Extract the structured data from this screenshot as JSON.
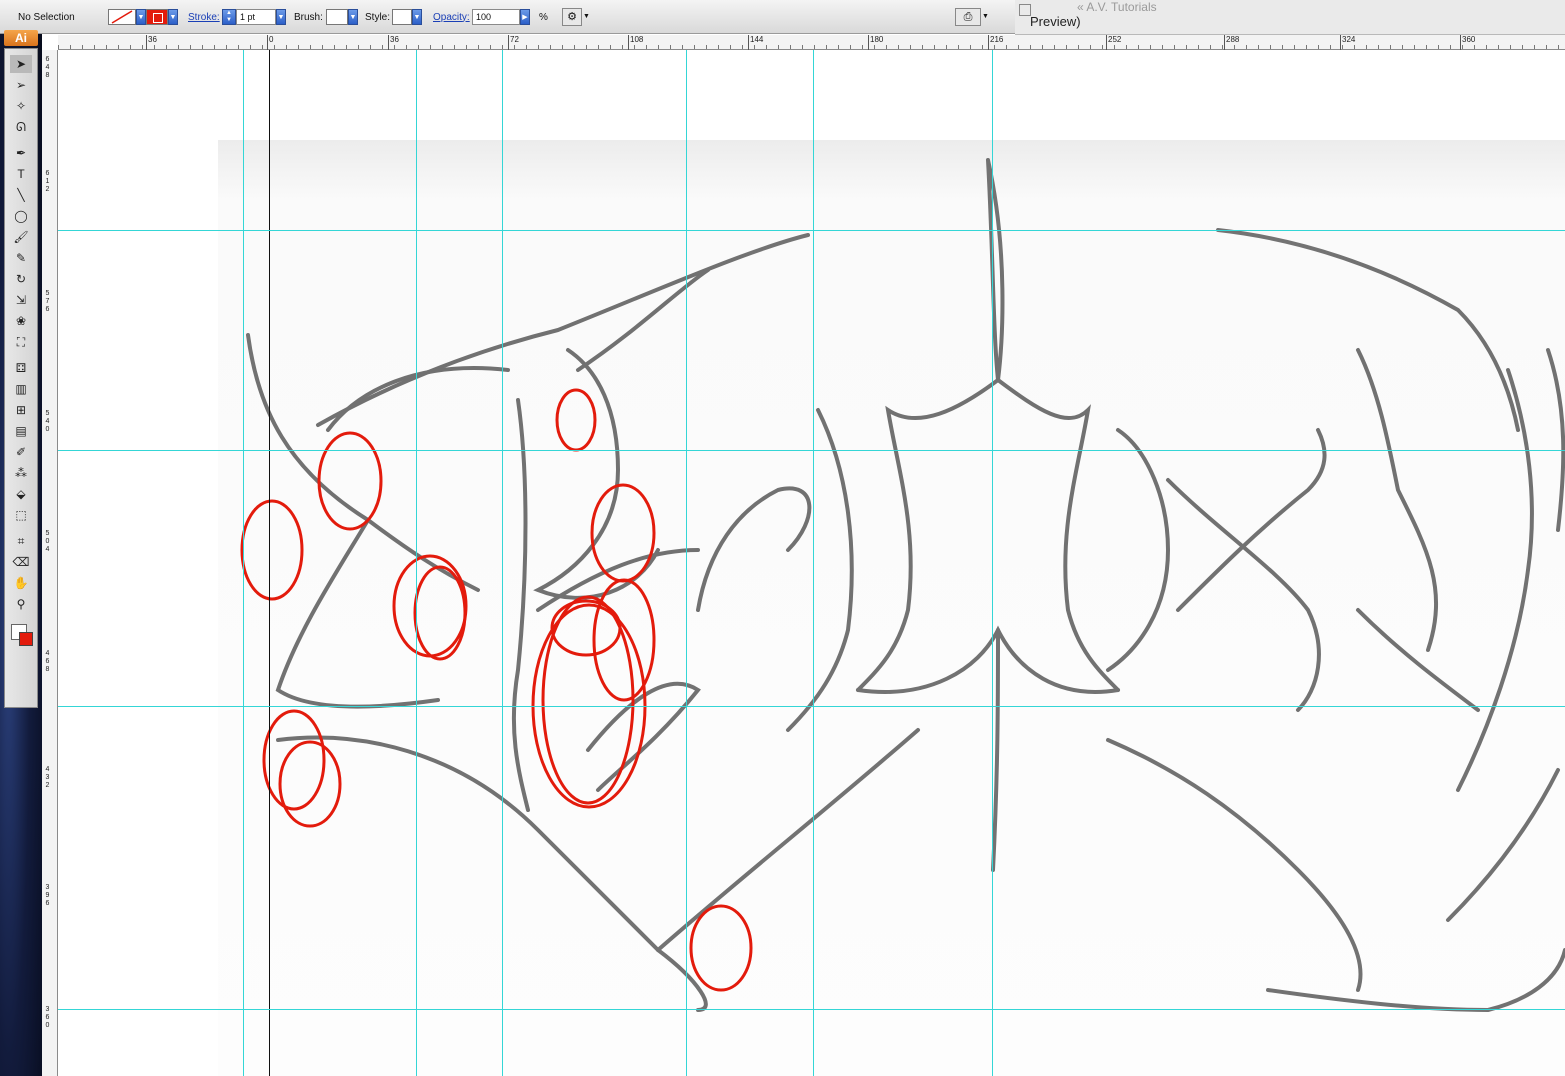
{
  "control_bar": {
    "selection_label": "No Selection",
    "stroke_label": "Stroke:",
    "stroke_value": "1 pt",
    "brush_label": "Brush:",
    "style_label": "Style:",
    "opacity_label": "Opacity:",
    "opacity_value": "100",
    "percent_sign": "%"
  },
  "window": {
    "title_fragment": "Preview)",
    "behind_title": "« A.V. Tutorials"
  },
  "app_badge": "Ai",
  "ruler_top_labels": [
    "36",
    "0",
    "36",
    "72",
    "108",
    "144",
    "180",
    "216",
    "252",
    "288",
    "324",
    "360"
  ],
  "ruler_left_labels": [
    "648",
    "612",
    "576",
    "540",
    "504",
    "468",
    "432",
    "396",
    "360"
  ],
  "tools": [
    {
      "name": "selection-tool",
      "glyph": "➤"
    },
    {
      "name": "direct-selection-tool",
      "glyph": "➢"
    },
    {
      "name": "magic-wand-tool",
      "glyph": "✧"
    },
    {
      "name": "lasso-tool",
      "glyph": "ᘏ"
    },
    {
      "name": "pen-tool",
      "glyph": "✒"
    },
    {
      "name": "type-tool",
      "glyph": "T"
    },
    {
      "name": "line-tool",
      "glyph": "╲"
    },
    {
      "name": "ellipse-tool",
      "glyph": "◯"
    },
    {
      "name": "paintbrush-tool",
      "glyph": "🖌"
    },
    {
      "name": "pencil-tool",
      "glyph": "✎"
    },
    {
      "name": "rotate-tool",
      "glyph": "↻"
    },
    {
      "name": "scale-tool",
      "glyph": "⇲"
    },
    {
      "name": "warp-tool",
      "glyph": "❀"
    },
    {
      "name": "free-transform-tool",
      "glyph": "⛶"
    },
    {
      "name": "symbol-sprayer-tool",
      "glyph": "⚃"
    },
    {
      "name": "graph-tool",
      "glyph": "▥"
    },
    {
      "name": "mesh-tool",
      "glyph": "⊞"
    },
    {
      "name": "gradient-tool",
      "glyph": "▤"
    },
    {
      "name": "eyedropper-tool",
      "glyph": "✐"
    },
    {
      "name": "blend-tool",
      "glyph": "⁂"
    },
    {
      "name": "live-paint-tool",
      "glyph": "⬙"
    },
    {
      "name": "live-paint-selection-tool",
      "glyph": "⬚"
    },
    {
      "name": "crop-tool",
      "glyph": "⌗"
    },
    {
      "name": "eraser-tool",
      "glyph": "⌫"
    },
    {
      "name": "hand-tool",
      "glyph": "✋"
    },
    {
      "name": "zoom-tool",
      "glyph": "⚲"
    }
  ],
  "colors": {
    "accent_red": "#e31b0c",
    "guide_cyan": "#34d6d6",
    "link_blue": "#1a3fb6"
  }
}
